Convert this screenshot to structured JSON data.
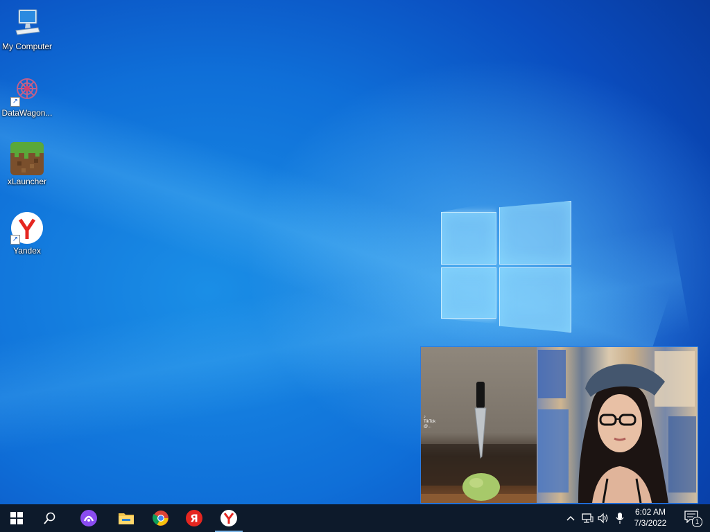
{
  "desktop": {
    "icons": [
      {
        "label": "My Computer",
        "icon": "computer-icon"
      },
      {
        "label": "DataWagon...",
        "icon": "datawagon-icon"
      },
      {
        "label": "xLauncher",
        "icon": "minecraft-grass-block-icon"
      },
      {
        "label": "Yandex",
        "icon": "yandex-browser-icon"
      }
    ]
  },
  "pip_video": {
    "watermark_brand": "TikTok",
    "watermark_handle": "@..."
  },
  "taskbar": {
    "buttons": [
      {
        "name": "start-button",
        "icon": "windows-logo-icon"
      },
      {
        "name": "search-button",
        "icon": "search-icon"
      },
      {
        "name": "alice-button",
        "icon": "yandex-alice-icon"
      },
      {
        "name": "file-explorer-button",
        "icon": "folder-icon"
      },
      {
        "name": "chrome-button",
        "icon": "chrome-icon"
      },
      {
        "name": "yandex-ya-button",
        "icon": "yandex-ya-icon"
      },
      {
        "name": "yandex-browser-button",
        "icon": "yandex-browser-icon"
      }
    ],
    "active_button": "yandex-browser-button",
    "tray": {
      "clock_time": "6:02 AM",
      "clock_date": "7/3/2022",
      "notification_count": "1"
    }
  },
  "colors": {
    "taskbar_bg": "#0d1a2b",
    "active_indicator": "#7cb7ea",
    "yandex_red": "#e52620",
    "alice_purple": "#8a4cf0"
  }
}
